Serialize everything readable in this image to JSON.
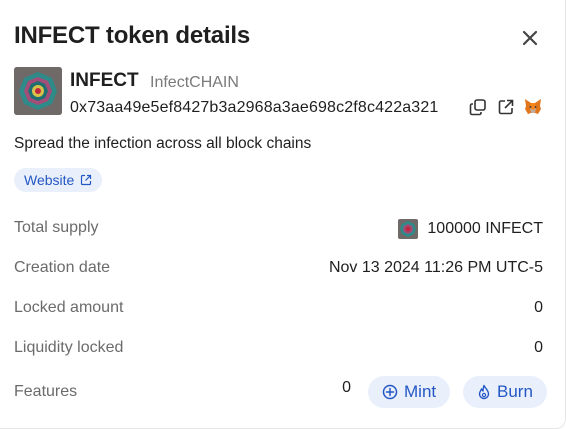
{
  "dialog": {
    "title": "INFECT token details",
    "close_icon": "close-icon"
  },
  "token": {
    "symbol": "INFECT",
    "name": "InfectCHAIN",
    "address": "0x73aa49e5ef8427b3a2968a3ae698c2f8c422a321",
    "icons": [
      "copy-icon",
      "external-link-icon",
      "metamask-fox-icon"
    ],
    "description": "Spread the infection across all block chains",
    "website_label": "Website"
  },
  "details": {
    "total_supply_label": "Total supply",
    "total_supply_value": "100000 INFECT",
    "creation_date_label": "Creation date",
    "creation_date_value": "Nov 13 2024 11:26 PM UTC-5",
    "locked_amount_label": "Locked amount",
    "locked_amount_value": "0",
    "liquidity_locked_label": "Liquidity locked",
    "liquidity_locked_value": "0",
    "features_label": "Features",
    "features_value": "0",
    "mint_label": "Mint",
    "burn_label": "Burn"
  },
  "colors": {
    "accent": "#2457c5",
    "pill_bg": "#e9f0fb",
    "label": "#6b6b6b",
    "text": "#1f1f1f"
  }
}
